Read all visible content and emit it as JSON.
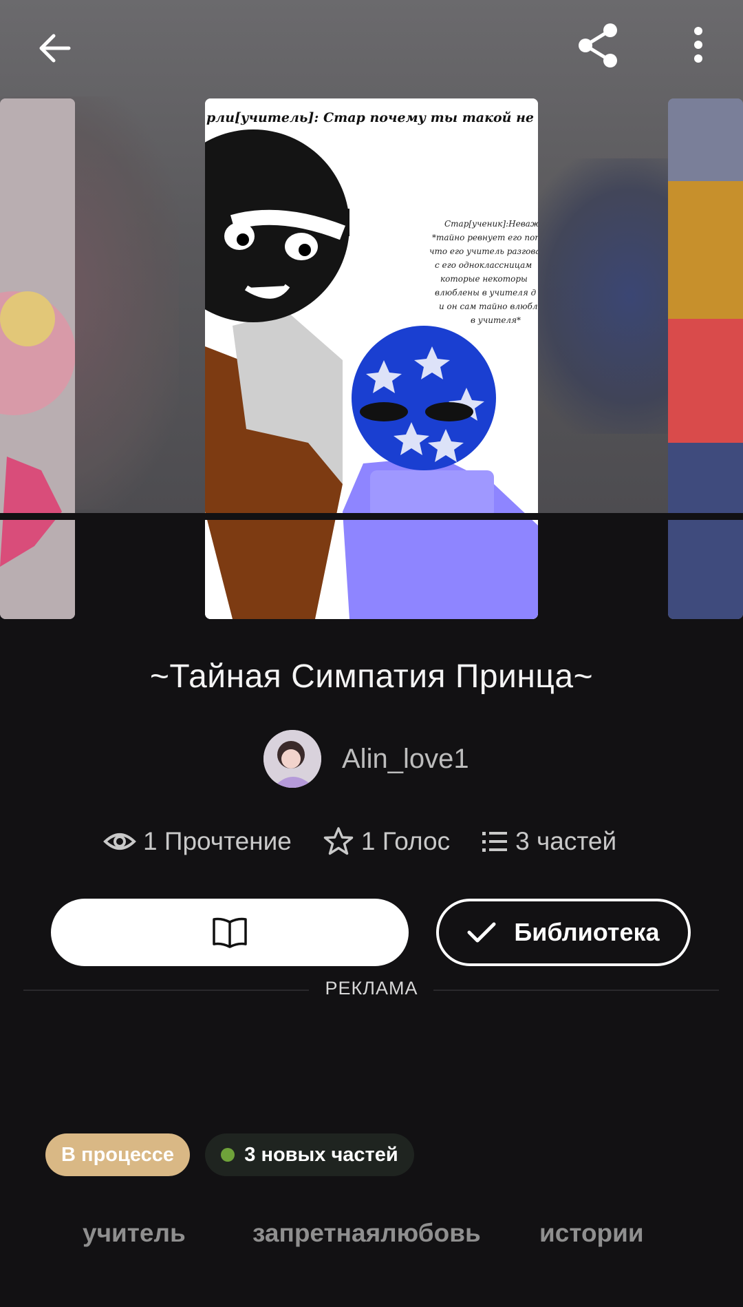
{
  "story": {
    "title": "~Тайная Симпатия Принца~",
    "author": "Alin_love1",
    "cover_caption_top": "рли[учитель]: Стар почему ты такой не довольн",
    "cover_caption_side": "Стар[ученик]:Неважн\n*тайно ревнует его пот\nчто его учитель разгова\nс его одноклассницам\nкоторые некоторы\nвлюблены в учителя д\nи он сам тайно влюбл\nв учителя*"
  },
  "stats": {
    "reads": "1 Прочтение",
    "votes": "1 Голос",
    "parts": "3 частей"
  },
  "actions": {
    "library_label": "Библиотека"
  },
  "ad": {
    "label": "РЕКЛАМА"
  },
  "badges": {
    "status": "В процессе",
    "new_parts": "3 новых частей"
  },
  "tags": [
    "учитель",
    "запретнаялюбовь",
    "истории"
  ],
  "icons": {
    "back": "arrow-left-icon",
    "share": "share-icon",
    "more": "more-vertical-icon",
    "reads": "eye-icon",
    "votes": "star-icon",
    "parts": "list-icon",
    "read": "book-open-icon",
    "library": "check-icon"
  },
  "colors": {
    "background": "#121113",
    "status_badge": "#d9b885",
    "new_dot": "#6fa23a"
  }
}
